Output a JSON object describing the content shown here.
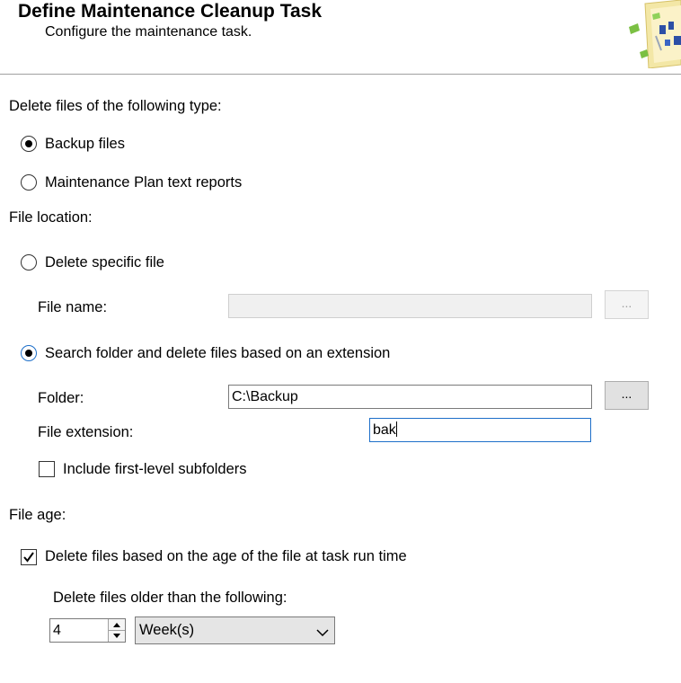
{
  "header": {
    "title": "Define Maintenance Cleanup Task",
    "subtitle": "Configure the maintenance task."
  },
  "file_type": {
    "section_label": "Delete files of the following type:",
    "options": [
      {
        "label": "Backup files",
        "checked": true
      },
      {
        "label": "Maintenance Plan text reports",
        "checked": false
      }
    ]
  },
  "file_location": {
    "section_label": "File location:",
    "delete_specific": {
      "label": "Delete specific file",
      "checked": false
    },
    "file_name": {
      "label": "File name:",
      "value": "",
      "browse_label": "..."
    },
    "search_folder": {
      "label": "Search folder and delete files based on an extension",
      "checked": true
    },
    "folder": {
      "label": "Folder:",
      "value": "C:\\Backup",
      "browse_label": "..."
    },
    "extension": {
      "label": "File extension:",
      "value": "bak"
    },
    "subfolders": {
      "label": "Include first-level subfolders",
      "checked": false
    }
  },
  "file_age": {
    "section_label": "File age:",
    "delete_by_age": {
      "label": "Delete files based on the age of the file at task run time",
      "checked": true
    },
    "older_than_label": "Delete files older than the following:",
    "amount": "4",
    "unit": "Week(s)"
  },
  "colors": {
    "focus_border": "#1d6fc9",
    "header_divider": "#a0a0a0"
  }
}
